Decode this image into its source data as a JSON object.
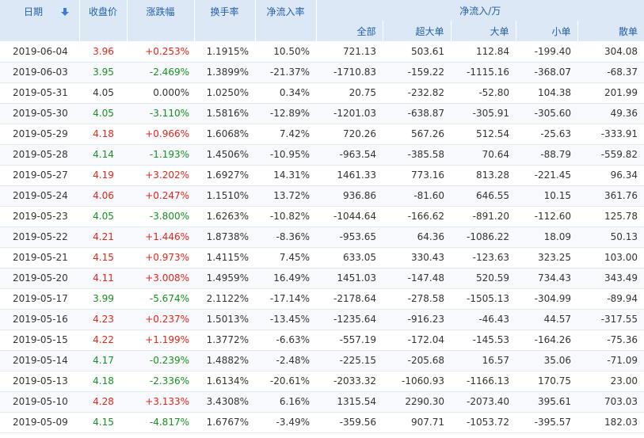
{
  "headers": {
    "date": "日期",
    "close": "收盘价",
    "change": "涨跌幅",
    "turnover": "换手率",
    "net_inflow_rate": "净流入率",
    "net_inflow_group": "净流入/万",
    "total": "全部",
    "super_large": "超大单",
    "large": "大单",
    "small": "小单",
    "retail": "散单"
  },
  "icons": {
    "sort": "sort-down-arrow-icon"
  },
  "colors": {
    "header_bg": "#dde8f6",
    "header_text": "#1f5fa8",
    "up": "#e3251a",
    "down": "#17911f"
  },
  "rows": [
    {
      "date": "2019-06-04",
      "close": "3.96",
      "change": "+0.253%",
      "turnover": "1.1915%",
      "rate": "10.50%",
      "total": "721.13",
      "super": "503.61",
      "large": "112.84",
      "small": "-199.40",
      "retail": "304.08",
      "dir": "up"
    },
    {
      "date": "2019-06-03",
      "close": "3.95",
      "change": "-2.469%",
      "turnover": "1.3899%",
      "rate": "-21.37%",
      "total": "-1710.83",
      "super": "-159.22",
      "large": "-1115.16",
      "small": "-368.07",
      "retail": "-68.37",
      "dir": "down"
    },
    {
      "date": "2019-05-31",
      "close": "4.05",
      "change": "0.000%",
      "turnover": "1.0250%",
      "rate": "0.34%",
      "total": "20.75",
      "super": "-232.82",
      "large": "-52.80",
      "small": "104.38",
      "retail": "201.99",
      "dir": "flat"
    },
    {
      "date": "2019-05-30",
      "close": "4.05",
      "change": "-3.110%",
      "turnover": "1.5816%",
      "rate": "-12.89%",
      "total": "-1201.03",
      "super": "-638.87",
      "large": "-305.91",
      "small": "-305.60",
      "retail": "49.36",
      "dir": "down"
    },
    {
      "date": "2019-05-29",
      "close": "4.18",
      "change": "+0.966%",
      "turnover": "1.6068%",
      "rate": "7.42%",
      "total": "720.26",
      "super": "567.26",
      "large": "512.54",
      "small": "-25.63",
      "retail": "-333.91",
      "dir": "up"
    },
    {
      "date": "2019-05-28",
      "close": "4.14",
      "change": "-1.193%",
      "turnover": "1.4506%",
      "rate": "-10.95%",
      "total": "-963.54",
      "super": "-385.58",
      "large": "70.64",
      "small": "-88.79",
      "retail": "-559.82",
      "dir": "down"
    },
    {
      "date": "2019-05-27",
      "close": "4.19",
      "change": "+3.202%",
      "turnover": "1.6927%",
      "rate": "14.31%",
      "total": "1461.33",
      "super": "773.16",
      "large": "813.28",
      "small": "-221.45",
      "retail": "96.34",
      "dir": "up"
    },
    {
      "date": "2019-05-24",
      "close": "4.06",
      "change": "+0.247%",
      "turnover": "1.1510%",
      "rate": "13.72%",
      "total": "936.86",
      "super": "-81.60",
      "large": "646.55",
      "small": "10.15",
      "retail": "361.76",
      "dir": "up"
    },
    {
      "date": "2019-05-23",
      "close": "4.05",
      "change": "-3.800%",
      "turnover": "1.6263%",
      "rate": "-10.82%",
      "total": "-1044.64",
      "super": "-166.62",
      "large": "-891.20",
      "small": "-112.60",
      "retail": "125.78",
      "dir": "down"
    },
    {
      "date": "2019-05-22",
      "close": "4.21",
      "change": "+1.446%",
      "turnover": "1.8738%",
      "rate": "-8.36%",
      "total": "-953.65",
      "super": "64.36",
      "large": "-1086.22",
      "small": "18.09",
      "retail": "50.13",
      "dir": "up"
    },
    {
      "date": "2019-05-21",
      "close": "4.15",
      "change": "+0.973%",
      "turnover": "1.4115%",
      "rate": "7.45%",
      "total": "633.05",
      "super": "330.43",
      "large": "-123.63",
      "small": "323.25",
      "retail": "103.00",
      "dir": "up"
    },
    {
      "date": "2019-05-20",
      "close": "4.11",
      "change": "+3.008%",
      "turnover": "1.4959%",
      "rate": "16.49%",
      "total": "1451.03",
      "super": "-147.48",
      "large": "520.59",
      "small": "734.43",
      "retail": "343.49",
      "dir": "up"
    },
    {
      "date": "2019-05-17",
      "close": "3.99",
      "change": "-5.674%",
      "turnover": "2.1122%",
      "rate": "-17.14%",
      "total": "-2178.64",
      "super": "-278.58",
      "large": "-1505.13",
      "small": "-304.99",
      "retail": "-89.94",
      "dir": "down"
    },
    {
      "date": "2019-05-16",
      "close": "4.23",
      "change": "+0.237%",
      "turnover": "1.5013%",
      "rate": "-13.45%",
      "total": "-1235.64",
      "super": "-916.23",
      "large": "-46.43",
      "small": "44.57",
      "retail": "-317.55",
      "dir": "up"
    },
    {
      "date": "2019-05-15",
      "close": "4.22",
      "change": "+1.199%",
      "turnover": "1.3772%",
      "rate": "-6.63%",
      "total": "-557.19",
      "super": "-172.04",
      "large": "-145.53",
      "small": "-164.26",
      "retail": "-75.36",
      "dir": "up"
    },
    {
      "date": "2019-05-14",
      "close": "4.17",
      "change": "-0.239%",
      "turnover": "1.4882%",
      "rate": "-2.48%",
      "total": "-225.15",
      "super": "-205.68",
      "large": "16.57",
      "small": "35.06",
      "retail": "-71.09",
      "dir": "down"
    },
    {
      "date": "2019-05-13",
      "close": "4.18",
      "change": "-2.336%",
      "turnover": "1.6134%",
      "rate": "-20.61%",
      "total": "-2033.32",
      "super": "-1060.93",
      "large": "-1166.13",
      "small": "170.75",
      "retail": "23.00",
      "dir": "down"
    },
    {
      "date": "2019-05-10",
      "close": "4.28",
      "change": "+3.133%",
      "turnover": "3.4308%",
      "rate": "6.16%",
      "total": "1315.54",
      "super": "2290.30",
      "large": "-2073.40",
      "small": "395.61",
      "retail": "703.03",
      "dir": "up"
    },
    {
      "date": "2019-05-09",
      "close": "4.15",
      "change": "-4.817%",
      "turnover": "1.6767%",
      "rate": "-3.49%",
      "total": "-359.56",
      "super": "907.71",
      "large": "-1053.72",
      "small": "-395.57",
      "retail": "182.03",
      "dir": "down"
    }
  ]
}
